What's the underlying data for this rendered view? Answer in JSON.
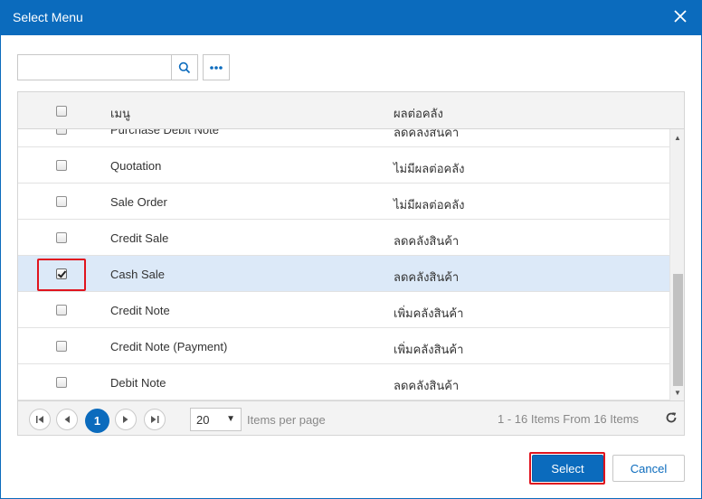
{
  "dialog": {
    "title": "Select Menu",
    "close_icon": "close-icon"
  },
  "toolbar": {
    "search_value": "",
    "search_placeholder": "",
    "search_icon": "search-icon",
    "more_icon": "more-options-icon"
  },
  "grid": {
    "columns": [
      "เมนู",
      "ผลต่อคลัง"
    ],
    "rows": [
      {
        "menu": "Purchase Debit Note",
        "effect": "ลดคลังสินค้า",
        "checked": false
      },
      {
        "menu": "Quotation",
        "effect": "ไม่มีผลต่อคลัง",
        "checked": false
      },
      {
        "menu": "Sale Order",
        "effect": "ไม่มีผลต่อคลัง",
        "checked": false
      },
      {
        "menu": "Credit Sale",
        "effect": "ลดคลังสินค้า",
        "checked": false
      },
      {
        "menu": "Cash Sale",
        "effect": "ลดคลังสินค้า",
        "checked": true
      },
      {
        "menu": "Credit Note",
        "effect": "เพิ่มคลังสินค้า",
        "checked": false
      },
      {
        "menu": "Credit Note (Payment)",
        "effect": "เพิ่มคลังสินค้า",
        "checked": false
      },
      {
        "menu": "Debit Note",
        "effect": "ลดคลังสินค้า",
        "checked": false
      }
    ]
  },
  "pager": {
    "current_page": "1",
    "page_size": "20",
    "items_per_page_label": "Items per page",
    "info": "1 - 16 Items From 16 Items",
    "first_icon": "first-page-icon",
    "prev_icon": "prev-page-icon",
    "next_icon": "next-page-icon",
    "last_icon": "last-page-icon",
    "refresh_icon": "refresh-icon"
  },
  "footer": {
    "select_label": "Select",
    "cancel_label": "Cancel"
  },
  "colors": {
    "accent": "#0b6bbd",
    "selected_row": "#dce9f8",
    "highlight": "#e0141e"
  }
}
